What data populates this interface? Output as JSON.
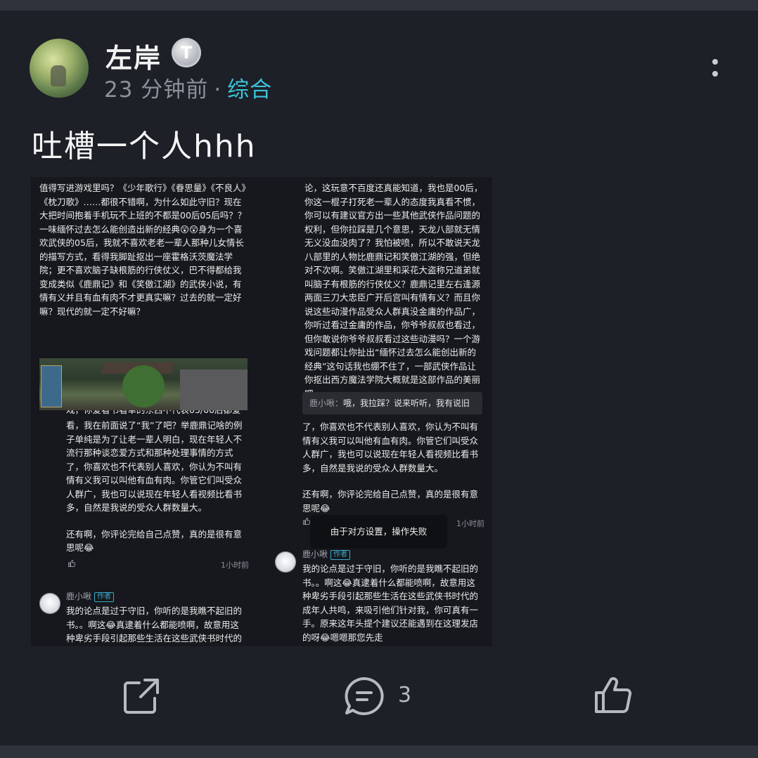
{
  "post": {
    "username": "左岸",
    "badge_letter": "T",
    "time_ago": "23 分钟前",
    "dot": "·",
    "category": "综合",
    "title": "吐槽一个人hhh"
  },
  "screenshot": {
    "left_main_text": "值得写进游戏里吗？《少年歌行》《眷思量》《不良人》《枕刀歌》……都很不错啊，为什么如此守旧？现在大把时间抱着手机玩不上班的不都是00后05后吗？？一味缅怀过去怎么能创造出新的经典😲😲身为一个喜欢武侠的05后，我就不喜欢老老一辈人那种儿女情长的描写方式，看得我脚趾抠出一座霍格沃茨魔法学院；更不喜欢脑子缺根筋的行侠仗义，巴不得都给我变成类似《鹿鼎记》和《笑傲江湖》的武侠小说，有情有义并且有血有肉不才更真实嘛？过去的就一定好嘛？现代的就一定不好嘛？",
    "left_cutoff_text": "戏，你爱看书看单的东西不代表05/00后都爱",
    "left_reply_p1": "看，我在前面说了“我”了吧？举鹿鼎记啥的例子单纯是为了让老一辈人明白，现在年轻人不流行那种谈恋爱方式和那种处理事情的方式了，你喜欢也不代表别人喜欢，你认为不叫有情有义我可以叫他有血有肉。你管它们叫受众人群广，我也可以说现在年轻人看视频比看书多，自然是我说的受众人群数量大。",
    "left_reply_p2": "还有啊，你评论完给自己点赞，真的是很有意思呢😂",
    "left_reply_time": "1小时前",
    "author_name": "鹿小啾",
    "author_tag": "作者",
    "left_author_text": "我的论点是过于守旧，你听的是我瞧不起旧的书。。啊这😂真逮着什么都能喷啊，故意用这种卑劣手段引起那些生活在这些武侠书时代的",
    "right_top_text": "论，这玩意不百度还真能知道，我也是00后，你这一棍子打死老一辈人的态度我真看不惯，你可以有建议官方出一些其他武侠作品问题的权利，但你拉踩是几个意思，天龙八部就无情无义没血没肉了？我怕被喷，所以不敢说天龙八部里的人物比鹿鼎记和笑傲江湖的强，但绝对不次啊。笑傲江湖里和采花大盗称兄道弟就叫脑子有根筋的行侠仗义？鹿鼎记里左右逢源两面三刀大忠臣广开后宫叫有情有义？而且你说这些动漫作品受众人群真没金庸的作品广，你听过看过金庸的作品，你爷爷叔叔也看过，但你敢说你爷爷叔叔看过这些动漫吗？一个游戏问题都让你扯出“缅怀过去怎么能创出新的经典”这句话我也绷不住了，一部武侠作品让你抠出西方魔法学院大概就是这部作品的美丽吧",
    "reply_preview_name": "鹿小啾：",
    "reply_preview_text": "哦，我拉踩？说来听听，我有说旧",
    "right_reply_p1": "了，你喜欢也不代表别人喜欢，你认为不叫有情有义我可以叫他有血有肉。你管它们叫受众人群广，我也可以说现在年轻人看视频比看书多，自然是我说的受众人群数量大。",
    "right_reply_p2": "还有啊，你评论完给自己点赞，真的是很有意思呢😂",
    "right_reply_time": "1小时前",
    "right_author_text": "我的论点是过于守旧，你听的是我瞧不起旧的书。。啊这😂真逮着什么都能喷啊，故意用这种卑劣手段引起那些生活在这些武侠书时代的成年人共鸣，来吸引他们针对我，你可真有一手。原来这年头提个建议还能遇到在这理发店的呀😂嗯嗯那您先走",
    "toast": "由于对方设置，操作失败"
  },
  "actions": {
    "comment_count": "3"
  },
  "icons": {
    "more": "more-vertical-icon",
    "share": "share-icon",
    "comment": "comment-icon",
    "like": "thumbs-up-icon"
  },
  "colors": {
    "background": "#1d2027",
    "accent": "#3bc4d9",
    "meta_text": "#8c9099"
  }
}
